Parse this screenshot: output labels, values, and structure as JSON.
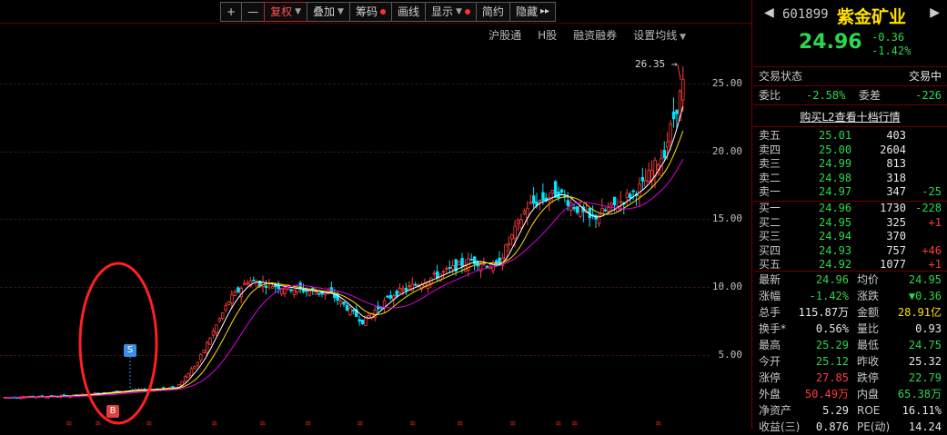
{
  "toolbar": {
    "plus": "+",
    "minus": "—",
    "fuquan": "复权",
    "diejia": "叠加",
    "choumǎ": "筹码",
    "huaxian": "画线",
    "xianshi": "显示",
    "jianyue": "简约",
    "yincang": "隐藏",
    "more": "▸▸"
  },
  "subnav": [
    "沪股通",
    "H股",
    "融资融券",
    "设置均线"
  ],
  "axis": {
    "labels": [
      "25.00",
      "20.00",
      "15.00",
      "10.00",
      "5.00"
    ]
  },
  "peak": {
    "label": "26.35"
  },
  "markers": {
    "s": "S",
    "b": "B"
  },
  "colors": {
    "up": "#ff3b3b",
    "down": "#00e5ff",
    "ma5": "#ffffff",
    "ma10": "#ffe000",
    "ma20": "#e000e0",
    "circle": "#ff2020"
  },
  "stock": {
    "code": "601899",
    "name": "紫金矿业",
    "price": "24.96",
    "change": "-0.36",
    "pct": "-1.42%"
  },
  "status": {
    "label": "交易状态",
    "value": "交易中"
  },
  "ratio": {
    "weibi_label": "委比",
    "weibi": "-2.58%",
    "weicha_label": "委差",
    "weicha": "-226"
  },
  "l2": "购买L2查看十档行情",
  "asks": [
    {
      "label": "卖五",
      "price": "25.01",
      "vol": "403",
      "delta": ""
    },
    {
      "label": "卖四",
      "price": "25.00",
      "vol": "2604",
      "delta": ""
    },
    {
      "label": "卖三",
      "price": "24.99",
      "vol": "813",
      "delta": ""
    },
    {
      "label": "卖二",
      "price": "24.98",
      "vol": "318",
      "delta": ""
    },
    {
      "label": "卖一",
      "price": "24.97",
      "vol": "347",
      "delta": "-25"
    }
  ],
  "bids": [
    {
      "label": "买一",
      "price": "24.96",
      "vol": "1730",
      "delta": "-228"
    },
    {
      "label": "买二",
      "price": "24.95",
      "vol": "325",
      "delta": "+1"
    },
    {
      "label": "买三",
      "price": "24.94",
      "vol": "370",
      "delta": ""
    },
    {
      "label": "买四",
      "price": "24.93",
      "vol": "757",
      "delta": "+46"
    },
    {
      "label": "买五",
      "price": "24.92",
      "vol": "1077",
      "delta": "+1"
    }
  ],
  "stats": [
    {
      "l1": "最新",
      "v1": "24.96",
      "l2": "均价",
      "v2": "24.95"
    },
    {
      "l1": "涨幅",
      "v1": "-1.42%",
      "l2": "涨跌",
      "v2": "▼0.36"
    },
    {
      "l1": "总手",
      "v1": "115.87万",
      "l2": "金额",
      "v2": "28.91亿"
    },
    {
      "l1": "换手*",
      "v1": "0.56%",
      "l2": "量比",
      "v2": "0.93"
    },
    {
      "l1": "最高",
      "v1": "25.29",
      "l2": "最低",
      "v2": "24.75"
    },
    {
      "l1": "今开",
      "v1": "25.12",
      "l2": "昨收",
      "v2": "25.32"
    },
    {
      "l1": "涨停",
      "v1": "27.85",
      "l2": "跌停",
      "v2": "22.79"
    },
    {
      "l1": "外盘",
      "v1": "50.49万",
      "l2": "内盘",
      "v2": "65.38万"
    },
    {
      "l1": "净资产",
      "v1": "5.29",
      "l2": "ROE",
      "v2": "16.11%"
    },
    {
      "l1": "收益(三)",
      "v1": "0.876",
      "l2": "PE(动)",
      "v2": "14.24"
    }
  ]
}
